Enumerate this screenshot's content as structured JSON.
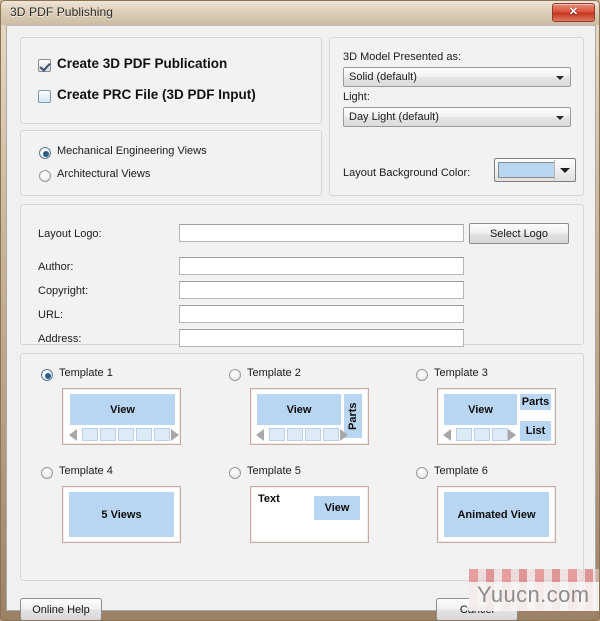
{
  "window": {
    "title": "3D PDF Publishing",
    "close_label": "✕"
  },
  "output_group": {
    "create_pdf": {
      "label": "Create 3D PDF Publication",
      "checked": "true"
    },
    "create_prc": {
      "label": "Create PRC File (3D PDF Input)",
      "checked": "false"
    }
  },
  "views_group": {
    "options": [
      {
        "label": "Mechanical Engineering Views",
        "selected": "true"
      },
      {
        "label": "Architectural Views",
        "selected": "false"
      }
    ]
  },
  "model_group": {
    "presented_as_label": "3D Model Presented as:",
    "presented_as_value": "Solid (default)",
    "light_label": "Light:",
    "light_value": "Day Light (default)",
    "background_color_label": "Layout Background Color:",
    "background_color_value": "#b8d6f2"
  },
  "meta_group": {
    "fields": [
      {
        "label": "Layout Logo:",
        "value": "",
        "placeholder": ""
      },
      {
        "label": "Author:",
        "value": "",
        "placeholder": ""
      },
      {
        "label": "Copyright:",
        "value": "",
        "placeholder": ""
      },
      {
        "label": "URL:",
        "value": "",
        "placeholder": ""
      },
      {
        "label": "Address:",
        "value": "",
        "placeholder": ""
      }
    ],
    "select_logo_button": "Select Logo"
  },
  "templates": [
    {
      "label": "Template 1",
      "selected": "true",
      "view_label": "View",
      "thumbnails": 5,
      "panels": []
    },
    {
      "label": "Template 2",
      "selected": "false",
      "view_label": "View",
      "thumbnails": 4,
      "panels": [
        "Parts"
      ]
    },
    {
      "label": "Template 3",
      "selected": "false",
      "view_label": "View",
      "thumbnails": 3,
      "panels": [
        "Parts",
        "List"
      ]
    },
    {
      "label": "Template 4",
      "selected": "false",
      "view_label": "5 Views",
      "thumbnails": 0,
      "panels": []
    },
    {
      "label": "Template 5",
      "selected": "false",
      "view_label": "View",
      "text_label": "Text",
      "thumbnails": 0,
      "panels": []
    },
    {
      "label": "Template 6",
      "selected": "false",
      "view_label": "Animated View",
      "thumbnails": 0,
      "panels": []
    }
  ],
  "footer": {
    "online_help": "Online Help",
    "cancel": "Cancel"
  },
  "watermark": {
    "text": "Yuucn.com"
  }
}
